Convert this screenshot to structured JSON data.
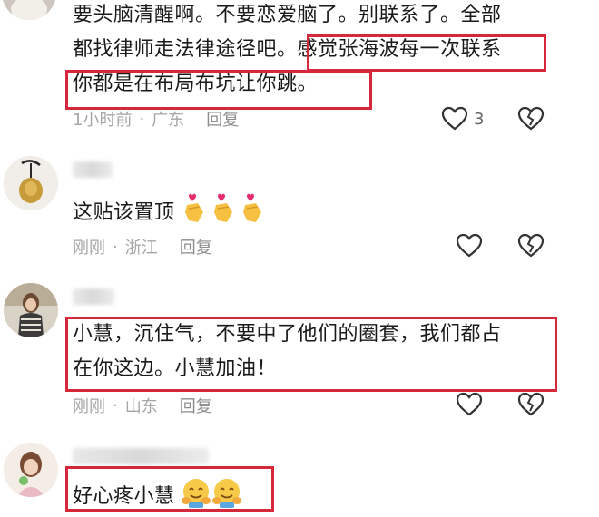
{
  "comments": [
    {
      "text_line1_a": "要头脑清醒啊。不要恋爱脑了。别联系了。全部",
      "text_line2_a": "都找律师走法律途径吧。",
      "text_line2_b": "感觉张海波每一次联系",
      "text_line3_a": "你都是在布局布坑让你跳。",
      "time": "1小时前",
      "location": "广东",
      "reply": "回复",
      "like_count": "3"
    },
    {
      "text": "这贴该置顶",
      "emoji": [
        "hand-heart",
        "hand-heart",
        "hand-heart"
      ],
      "time": "刚刚",
      "location": "浙江",
      "reply": "回复"
    },
    {
      "text_line1": "小慧，沉住气，不要中了他们的圈套，我们都占",
      "text_line2": "在你这边。小慧加油！",
      "time": "刚刚",
      "location": "山东",
      "reply": "回复"
    },
    {
      "text": "好心疼小慧",
      "emoji": [
        "hugging-face",
        "hugging-face"
      ]
    }
  ],
  "separator": "·",
  "colors": {
    "highlight": "#d6283a",
    "meta": "#a6a6a6"
  }
}
